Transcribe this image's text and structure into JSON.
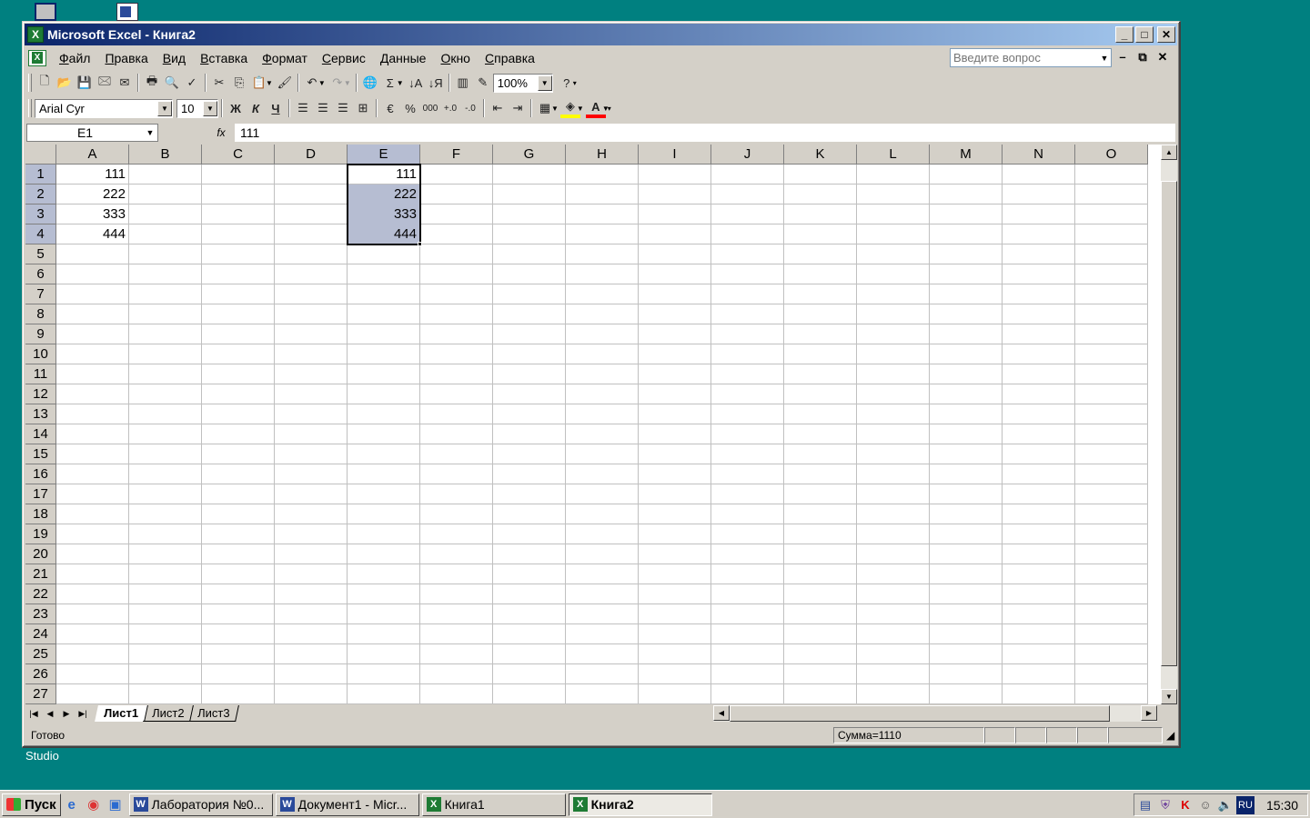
{
  "desktop": {
    "labels": [
      "Studio"
    ]
  },
  "window": {
    "title": "Microsoft Excel - Книга2"
  },
  "menu": {
    "items": [
      "Файл",
      "Правка",
      "Вид",
      "Вставка",
      "Формат",
      "Сервис",
      "Данные",
      "Окно",
      "Справка"
    ],
    "help_placeholder": "Введите вопрос"
  },
  "toolbar": {
    "zoom": "100%",
    "font_name": "Arial Cyr",
    "font_size": "10",
    "bold": "Ж",
    "italic": "К",
    "underline": "Ч",
    "percent": "%",
    "thousands": "000",
    "sum": "Σ"
  },
  "formula_bar": {
    "name_box": "E1",
    "fx": "fx",
    "content": "111"
  },
  "sheet": {
    "columns": [
      "A",
      "B",
      "C",
      "D",
      "E",
      "F",
      "G",
      "H",
      "I",
      "J",
      "K",
      "L",
      "M",
      "N",
      "O"
    ],
    "rows": [
      "1",
      "2",
      "3",
      "4",
      "5",
      "6",
      "7",
      "8",
      "9",
      "10",
      "11",
      "12",
      "13",
      "14",
      "15",
      "16",
      "17",
      "18",
      "19",
      "20",
      "21",
      "22",
      "23",
      "24",
      "25",
      "26",
      "27"
    ],
    "cells": {
      "A1": "111",
      "A2": "222",
      "A3": "333",
      "A4": "444",
      "E1": "111",
      "E2": "222",
      "E3": "333",
      "E4": "444"
    },
    "selection": "E1:E4"
  },
  "tabs": [
    "Лист1",
    "Лист2",
    "Лист3"
  ],
  "status": {
    "ready": "Готово",
    "sum": "Сумма=1110"
  },
  "taskbar": {
    "start": "Пуск",
    "tasks": [
      "Лаборатория №0...",
      "Документ1 - Micr...",
      "Книга1",
      "Книга2"
    ],
    "lang": "RU",
    "time": "15:30"
  },
  "colors": {
    "desktop": "#008080",
    "titlebar": "#0a246a",
    "selection": "#b6bdd2",
    "excel_green": "#1e7b34"
  }
}
